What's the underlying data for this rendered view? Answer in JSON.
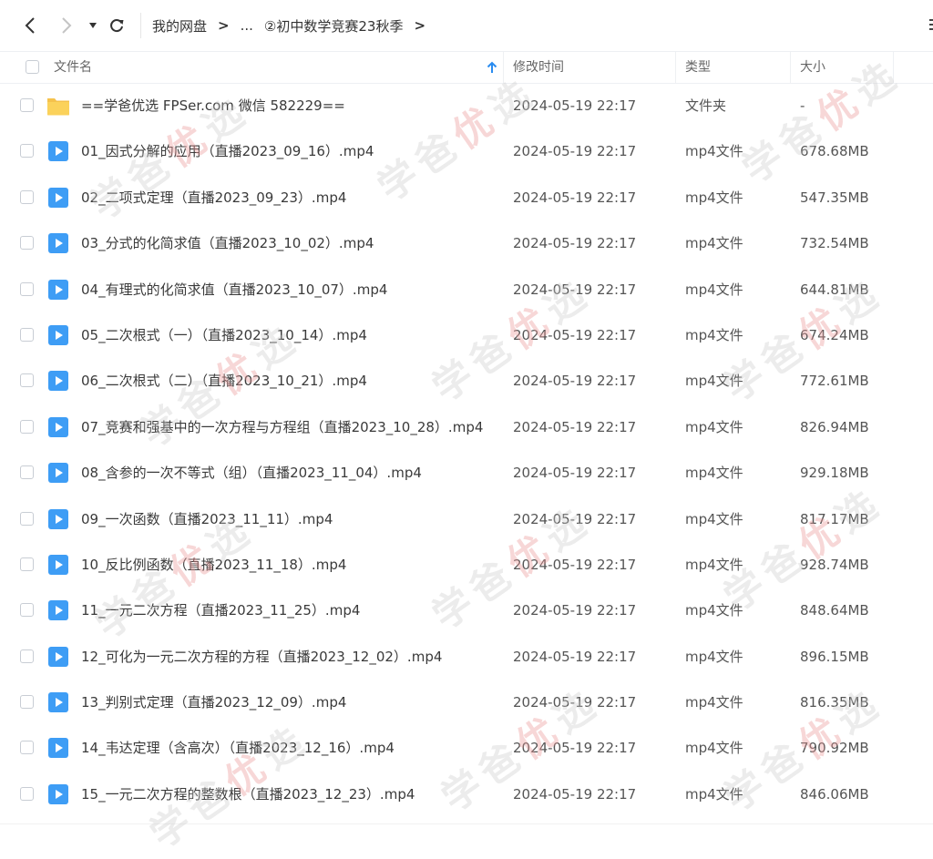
{
  "breadcrumb": {
    "root": "我的网盘",
    "ellipsis": "...",
    "current": "②初中数学竞赛23秋季",
    "sep": ">"
  },
  "columns": {
    "name": "文件名",
    "modified": "修改时间",
    "type": "类型",
    "size": "大小"
  },
  "watermark": {
    "part1": "学爸",
    "part2": "优",
    "part3": "选"
  },
  "files": [
    {
      "name": "==学爸优选 FPSer.com 微信 582229==",
      "date": "2024-05-19 22:17",
      "type": "文件夹",
      "size": "-",
      "kind": "folder"
    },
    {
      "name": "01_因式分解的应用（直播2023_09_16）.mp4",
      "date": "2024-05-19 22:17",
      "type": "mp4文件",
      "size": "678.68MB",
      "kind": "video"
    },
    {
      "name": "02_二项式定理（直播2023_09_23）.mp4",
      "date": "2024-05-19 22:17",
      "type": "mp4文件",
      "size": "547.35MB",
      "kind": "video"
    },
    {
      "name": "03_分式的化简求值（直播2023_10_02）.mp4",
      "date": "2024-05-19 22:17",
      "type": "mp4文件",
      "size": "732.54MB",
      "kind": "video"
    },
    {
      "name": "04_有理式的化简求值（直播2023_10_07）.mp4",
      "date": "2024-05-19 22:17",
      "type": "mp4文件",
      "size": "644.81MB",
      "kind": "video"
    },
    {
      "name": "05_二次根式（一）（直播2023_10_14）.mp4",
      "date": "2024-05-19 22:17",
      "type": "mp4文件",
      "size": "674.24MB",
      "kind": "video"
    },
    {
      "name": "06_二次根式（二）（直播2023_10_21）.mp4",
      "date": "2024-05-19 22:17",
      "type": "mp4文件",
      "size": "772.61MB",
      "kind": "video"
    },
    {
      "name": "07_竞赛和强基中的一次方程与方程组（直播2023_10_28）.mp4",
      "date": "2024-05-19 22:17",
      "type": "mp4文件",
      "size": "826.94MB",
      "kind": "video"
    },
    {
      "name": "08_含参的一次不等式（组）（直播2023_11_04）.mp4",
      "date": "2024-05-19 22:17",
      "type": "mp4文件",
      "size": "929.18MB",
      "kind": "video"
    },
    {
      "name": "09_一次函数（直播2023_11_11）.mp4",
      "date": "2024-05-19 22:17",
      "type": "mp4文件",
      "size": "817.17MB",
      "kind": "video"
    },
    {
      "name": "10_反比例函数（直播2023_11_18）.mp4",
      "date": "2024-05-19 22:17",
      "type": "mp4文件",
      "size": "928.74MB",
      "kind": "video"
    },
    {
      "name": "11_一元二次方程（直播2023_11_25）.mp4",
      "date": "2024-05-19 22:17",
      "type": "mp4文件",
      "size": "848.64MB",
      "kind": "video"
    },
    {
      "name": "12_可化为一元二次方程的方程（直播2023_12_02）.mp4",
      "date": "2024-05-19 22:17",
      "type": "mp4文件",
      "size": "896.15MB",
      "kind": "video"
    },
    {
      "name": "13_判别式定理（直播2023_12_09）.mp4",
      "date": "2024-05-19 22:17",
      "type": "mp4文件",
      "size": "816.35MB",
      "kind": "video"
    },
    {
      "name": "14_韦达定理（含高次）（直播2023_12_16）.mp4",
      "date": "2024-05-19 22:17",
      "type": "mp4文件",
      "size": "790.92MB",
      "kind": "video"
    },
    {
      "name": "15_一元二次方程的整数根（直播2023_12_23）.mp4",
      "date": "2024-05-19 22:17",
      "type": "mp4文件",
      "size": "846.06MB",
      "kind": "video"
    }
  ]
}
